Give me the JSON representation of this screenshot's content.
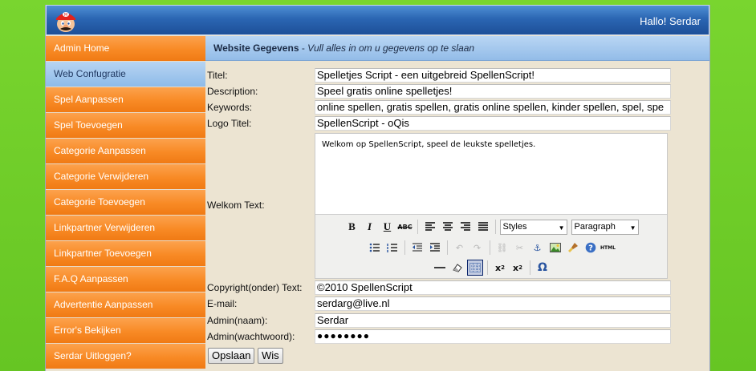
{
  "header": {
    "greeting": "Hallo! Serdar",
    "logo_icon": "mario-head-icon",
    "colors": {
      "header_top": "#4f8fd4",
      "header_bottom": "#1d4f98",
      "background": "#6fcf2a"
    }
  },
  "sidebar": {
    "items": [
      {
        "label": "Admin Home",
        "active": false
      },
      {
        "label": "Web Confugratie",
        "active": true
      },
      {
        "label": "Spel Aanpassen",
        "active": false
      },
      {
        "label": "Spel Toevoegen",
        "active": false
      },
      {
        "label": "Categorie Aanpassen",
        "active": false
      },
      {
        "label": "Categorie Verwijderen",
        "active": false
      },
      {
        "label": "Categorie Toevoegen",
        "active": false
      },
      {
        "label": "Linkpartner Verwijderen",
        "active": false
      },
      {
        "label": "Linkpartner Toevoegen",
        "active": false
      },
      {
        "label": "F.A.Q Aanpassen",
        "active": false
      },
      {
        "label": "Advertentie Aanpassen",
        "active": false
      },
      {
        "label": "Error's Bekijken",
        "active": false
      },
      {
        "label": "Serdar Uitloggen?",
        "active": false
      }
    ],
    "colors": {
      "item": "#f88a25",
      "active": "#8ebbe9"
    }
  },
  "main": {
    "title_bold": "Website Gegevens",
    "title_sep": " - ",
    "title_italic": "Vull alles in om u gegevens op te slaan",
    "fields": {
      "titel": {
        "label": "Titel:",
        "value": "Spelletjes Script - een uitgebreid SpellenScript!"
      },
      "description": {
        "label": "Description:",
        "value": "Speel gratis online spelletjes!"
      },
      "keywords": {
        "label": "Keywords:",
        "value": "online spellen, gratis spellen, gratis online spellen, kinder spellen, spel, spe"
      },
      "logo_titel": {
        "label": "Logo Titel:",
        "value": "SpellenScript - oQis"
      },
      "welkom": {
        "label": "Welkom Text:",
        "value": "Welkom op SpellenScript, speel de leukste spelletjes."
      },
      "copyright": {
        "label": "Copyright(onder) Text:",
        "value": "©2010 SpellenScript"
      },
      "email": {
        "label": "E-mail:",
        "value": "serdarg@live.nl"
      },
      "admin_naam": {
        "label": "Admin(naam):",
        "value": "Serdar"
      },
      "admin_wachtwoord": {
        "label": "Admin(wachtwoord):",
        "value": "●●●●●●●●"
      }
    },
    "editor": {
      "styles_select": "Styles",
      "format_select": "Paragraph",
      "row1_icons": [
        "bold-icon",
        "italic-icon",
        "underline-icon",
        "strikethrough-icon",
        "align-left-icon",
        "align-center-icon",
        "align-right-icon",
        "align-justify-icon"
      ],
      "row2_icons": [
        "bullet-list-icon",
        "numbered-list-icon",
        "outdent-icon",
        "indent-icon",
        "undo-icon",
        "redo-icon",
        "link-icon",
        "unlink-icon",
        "anchor-icon",
        "image-icon",
        "cleanup-icon",
        "help-icon",
        "html-icon"
      ],
      "row3_icons": [
        "horizontal-rule-icon",
        "remove-format-icon",
        "visual-aid-icon",
        "subscript-icon",
        "superscript-icon",
        "special-char-icon"
      ],
      "glyphs": {
        "bold": "B",
        "italic": "I",
        "underline": "U",
        "strike": "ABC",
        "omega": "Ω",
        "html": "HTML"
      }
    },
    "buttons": {
      "save": "Opslaan",
      "reset": "Wis"
    }
  }
}
